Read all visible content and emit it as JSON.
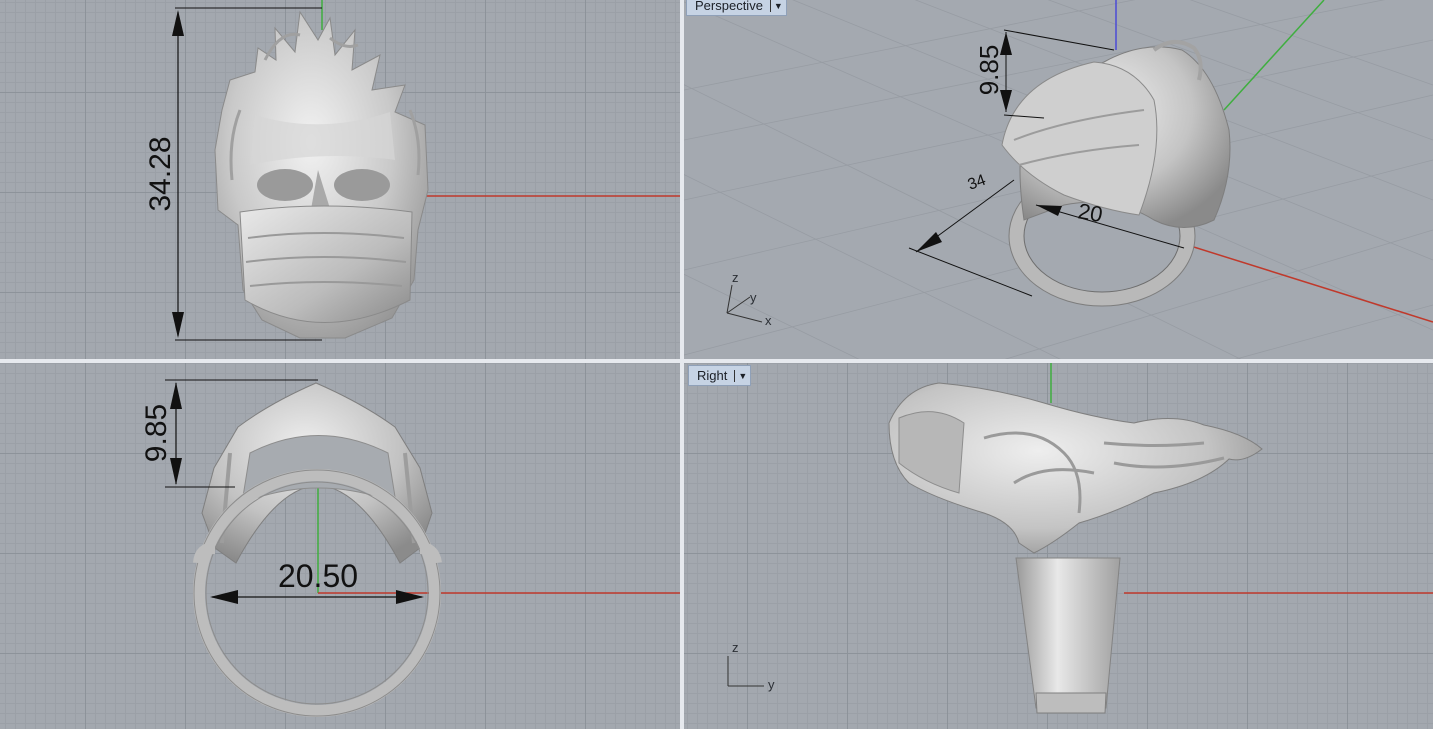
{
  "viewports": {
    "top": {
      "dimension_height": "34.28"
    },
    "perspective": {
      "label": "Perspective",
      "dimension_height": "9.85",
      "dimension_partial_a": "34",
      "dimension_partial_b": "20",
      "axes": {
        "z": "z",
        "y": "y",
        "x": "x"
      }
    },
    "front": {
      "dimension_height": "9.85",
      "dimension_width": "20.50"
    },
    "right": {
      "label": "Right",
      "axes": {
        "z": "z",
        "y": "y"
      }
    }
  },
  "icons": {
    "dropdown": "dropdown-arrow-icon"
  },
  "colors": {
    "grid_bg": "#a3a8af",
    "x_axis": "#c0392b",
    "y_axis": "#3fae3f",
    "z_axis": "#4b4bd6",
    "model": "#c9c9c9",
    "active_label": "#c6d3e4"
  }
}
